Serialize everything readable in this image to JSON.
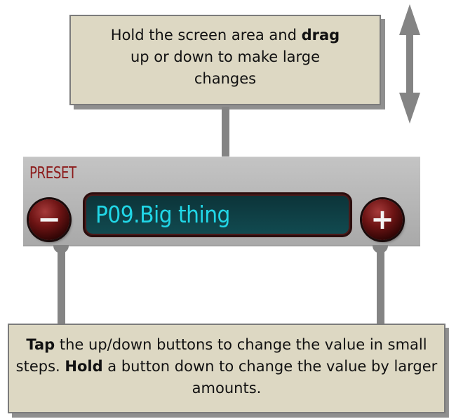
{
  "top_callout": {
    "line1_pre": "Hold the screen area and ",
    "line1_bold": "drag",
    "line2": "up or down to make large",
    "line3": "changes"
  },
  "preset": {
    "label": "PRESET",
    "value": "P09.Big thing",
    "minus_symbol": "−",
    "plus_symbol": "+"
  },
  "bottom_callout": {
    "bold1": "Tap",
    "text1": " the up/down buttons to change the value in small steps.  ",
    "bold2": "Hold",
    "text2": " a button down to change the value by larger amounts."
  },
  "colors": {
    "callout_bg": "#ddd8c3",
    "label_red": "#8c1b1b",
    "display_text": "#21d6e6",
    "connector_gray": "#848484"
  },
  "icons": {
    "arrow": "double-headed-vertical-arrow",
    "minus": "minus-icon",
    "plus": "plus-icon"
  }
}
